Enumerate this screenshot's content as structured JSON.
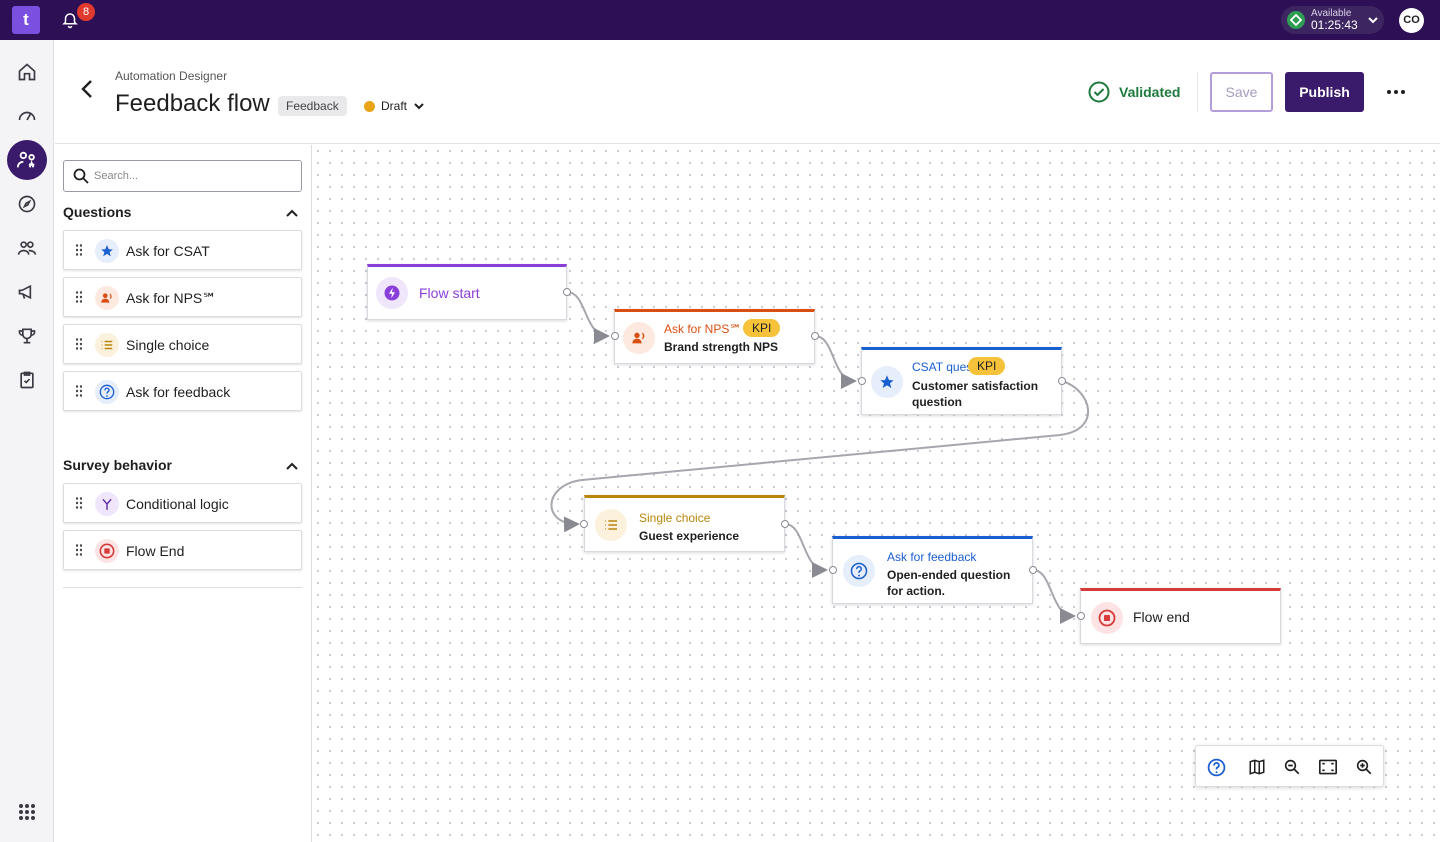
{
  "topbar": {
    "logo_text": "t",
    "notifications_count": "8",
    "status_label": "Available",
    "status_time": "01:25:43",
    "avatar_initials": "CO"
  },
  "header": {
    "breadcrumb": "Automation Designer",
    "title": "Feedback flow",
    "tag": "Feedback",
    "state": "Draft",
    "validation": "Validated",
    "save_label": "Save",
    "publish_label": "Publish"
  },
  "panel": {
    "search_placeholder": "Search...",
    "questions_title": "Questions",
    "questions": [
      {
        "label": "Ask for CSAT",
        "icon": "star-icon"
      },
      {
        "label": "Ask for NPS℠",
        "icon": "nps-people-icon"
      },
      {
        "label": "Single choice",
        "icon": "list-icon"
      },
      {
        "label": "Ask for feedback",
        "icon": "question-icon"
      }
    ],
    "behavior_title": "Survey behavior",
    "behavior": [
      {
        "label": "Conditional logic",
        "icon": "branch-icon"
      },
      {
        "label": "Flow End",
        "icon": "stop-icon"
      }
    ]
  },
  "flow": {
    "nodes": [
      {
        "type": "Flow start",
        "accent": "#8b3fd9"
      },
      {
        "type": "Ask for NPS℠",
        "kpi": "KPI",
        "subtitle": "Brand strength NPS",
        "accent": "#d94f12"
      },
      {
        "type": "CSAT question",
        "kpi": "KPI",
        "subtitle": "Customer satisfaction question",
        "accent": "#1a5fd1"
      },
      {
        "type": "Single choice",
        "subtitle": "Guest experience",
        "accent": "#b8860b"
      },
      {
        "type": "Ask for feedback",
        "subtitle": "Open-ended question for action.",
        "accent": "#1a5fd1"
      },
      {
        "type": "Flow end",
        "accent": "#d63a3a"
      }
    ]
  },
  "colors": {
    "topbar": "#2d0f55",
    "primary": "#3a1a6b",
    "valid": "#1e7a3c"
  }
}
